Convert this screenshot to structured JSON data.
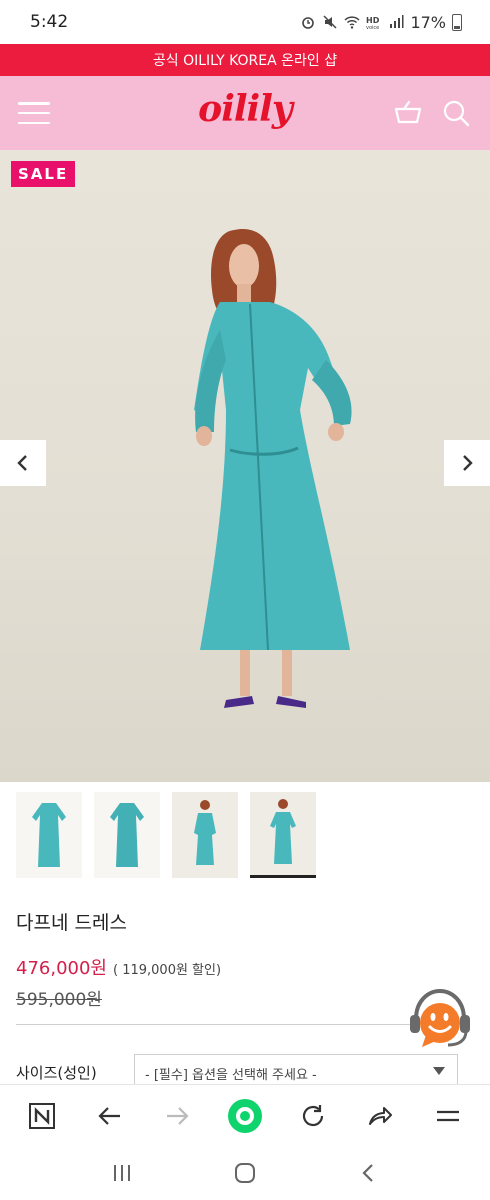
{
  "status_bar": {
    "time": "5:42",
    "battery": "17%",
    "icons": [
      "alarm-icon",
      "mute-icon",
      "wifi-icon",
      "hd-voice-icon",
      "signal-icon",
      "battery-icon"
    ]
  },
  "announcement": "공식 OILILY KOREA 온라인 샵",
  "header": {
    "logo": "oilily",
    "icons": [
      "menu-icon",
      "basket-icon",
      "search-icon"
    ]
  },
  "gallery": {
    "badge": "SALE",
    "thumbnail_count": 4,
    "active_thumbnail": 4
  },
  "product": {
    "name": "다프네 드레스",
    "sale_price": "476,000원",
    "discount": "( 119,000원 할인)",
    "original_price": "595,000원"
  },
  "options": {
    "size_label": "사이즈(성인)",
    "size_placeholder": "- [필수] 옵션을 선택해 주세요 -"
  },
  "browser_toolbar": {
    "icons": [
      "naver-icon",
      "back-arrow-icon",
      "forward-arrow-icon",
      "home-dot-icon",
      "refresh-icon",
      "share-icon",
      "hamburger-icon"
    ]
  },
  "system_nav": {
    "icons": [
      "recent-apps-icon",
      "home-icon",
      "back-icon"
    ]
  },
  "colors": {
    "banner": "#ec1c3f",
    "header_bg": "#f6bcd6",
    "logo": "#e4122a",
    "sale_badge": "#e8106a",
    "sale_price": "#d3204a",
    "dress": "#49b8bd"
  }
}
